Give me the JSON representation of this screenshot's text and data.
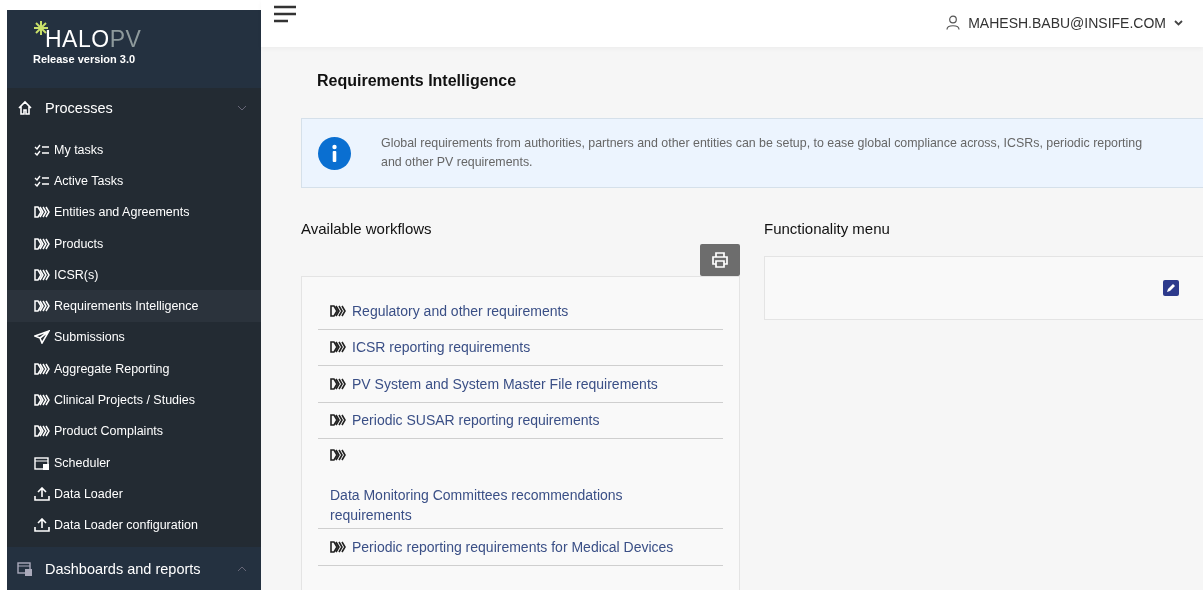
{
  "brand": {
    "logo_main": "HALO",
    "logo_accent": "PV",
    "release": "Release version 3.0"
  },
  "sidebar": {
    "sections": [
      {
        "label": "Processes",
        "kind": "home",
        "expanded": true,
        "items": [
          {
            "label": "My tasks",
            "kind": "checklist",
            "selected": false
          },
          {
            "label": "Active Tasks",
            "kind": "checklist",
            "selected": false
          },
          {
            "label": "Entities and Agreements",
            "kind": "chevrons",
            "selected": false
          },
          {
            "label": "Products",
            "kind": "chevrons",
            "selected": false
          },
          {
            "label": "ICSR(s)",
            "kind": "chevrons",
            "selected": false
          },
          {
            "label": "Requirements Intelligence",
            "kind": "chevrons",
            "selected": true
          },
          {
            "label": "Submissions",
            "kind": "plane",
            "selected": false
          },
          {
            "label": "Aggregate Reporting",
            "kind": "chevrons",
            "selected": false
          },
          {
            "label": "Clinical Projects / Studies",
            "kind": "chevrons",
            "selected": false
          },
          {
            "label": "Product Complaints",
            "kind": "chevrons",
            "selected": false
          },
          {
            "label": "Scheduler",
            "kind": "calendar",
            "selected": false
          },
          {
            "label": "Data Loader",
            "kind": "upload",
            "selected": false
          },
          {
            "label": "Data Loader configuration",
            "kind": "upload",
            "selected": false
          }
        ]
      },
      {
        "label": "Dashboards and reports",
        "kind": "dashboard",
        "expanded": false
      }
    ]
  },
  "header": {
    "user": "MAHESH.BABU@INSIFE.COM"
  },
  "page": {
    "title": "Requirements Intelligence",
    "info": "Global requirements from authorities, partners and other entities can be setup, to ease global compliance across, ICSRs, periodic reporting and other PV requirements."
  },
  "workflows": {
    "title": "Available workflows",
    "items": [
      {
        "label": "Regulatory and other requirements",
        "kind": "inline"
      },
      {
        "label": "ICSR reporting requirements",
        "kind": "inline"
      },
      {
        "label": "PV System and System Master File requirements",
        "kind": "inline"
      },
      {
        "label": "Periodic SUSAR reporting requirements",
        "kind": "inline"
      },
      {
        "label": "Data Monitoring Committees recommendations requirements",
        "kind": "stacked"
      },
      {
        "label": "Periodic reporting requirements for Medical Devices",
        "kind": "inline"
      }
    ]
  },
  "functionality": {
    "title": "Functionality menu"
  }
}
